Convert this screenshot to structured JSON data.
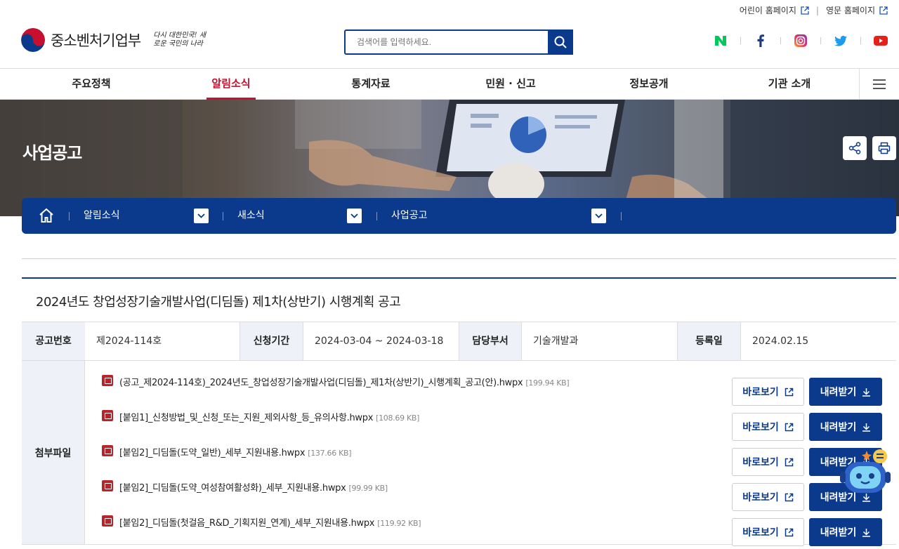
{
  "utility": {
    "kids_home": "어린이 홈페이지",
    "english_home": "영문 홈페이지"
  },
  "brand": {
    "name": "중소벤처기업부",
    "slogan": "다시 대한민국! 새로운 국민의 나라"
  },
  "search": {
    "placeholder": "검색어를 입력하세요."
  },
  "sns": [
    "naver-icon",
    "facebook-icon",
    "instagram-icon",
    "twitter-icon",
    "youtube-icon"
  ],
  "gnb": {
    "items": [
      {
        "label": "주요정책"
      },
      {
        "label": "알림소식"
      },
      {
        "label": "통계자료"
      },
      {
        "label": "민원 · 신고"
      },
      {
        "label": "정보공개"
      },
      {
        "label": "기관 소개"
      }
    ],
    "active_index": 1
  },
  "hero": {
    "title": "사업공고"
  },
  "location": {
    "level1": "알림소식",
    "level2": "새소식",
    "level3": "사업공고"
  },
  "post": {
    "title": "2024년도 창업성장기술개발사업(디딤돌) 제1차(상반기) 시행계획 공고",
    "info": [
      {
        "label": "공고번호",
        "value": "제2024-114호"
      },
      {
        "label": "신청기간",
        "value": "2024-03-04 ~ 2024-03-18"
      },
      {
        "label": "담당부서",
        "value": "기술개발과"
      },
      {
        "label": "등록일",
        "value": "2024.02.15"
      }
    ],
    "files_label": "첨부파일",
    "view_label": "바로보기",
    "download_label": "내려받기",
    "files": [
      {
        "name": "(공고_제2024-114호)_2024년도_창업성장기술개발사업(디딤돌)_제1차(상반기)_시행계획_공고(안).hwpx",
        "size": "[199.94 KB]"
      },
      {
        "name": "[붙임1]_신청방법_및_신청_또는_지원_제외사항_등_유의사항.hwpx",
        "size": "[108.69 KB]"
      },
      {
        "name": "[붙임2]_디딤돌(도약_일반)_세부_지원내용.hwpx",
        "size": "[137.66 KB]"
      },
      {
        "name": "[붙임2]_디딤돌(도약_여성참여활성화)_세부_지원내용.hwpx",
        "size": "[99.99 KB]"
      },
      {
        "name": "[붙임2]_디딤돌(첫걸음_R&D_기획지원_연계)_세부_지원내용.hwpx",
        "size": "[119.92 KB]"
      }
    ]
  },
  "colors": {
    "primary": "#0b3a8c",
    "accent": "#c8102e",
    "header_bg": "#eef2f8"
  }
}
